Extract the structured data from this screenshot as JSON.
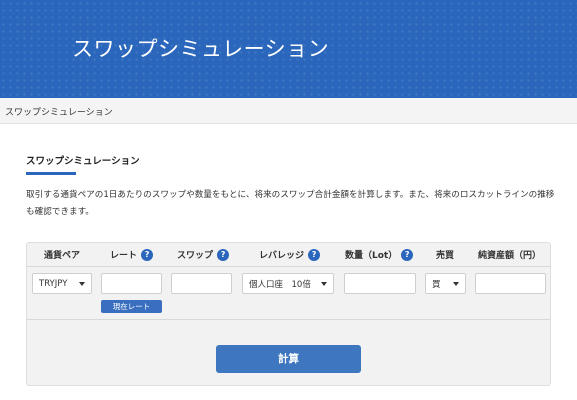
{
  "hero": {
    "title": "スワップシミュレーション"
  },
  "breadcrumb": {
    "current": "スワップシミュレーション"
  },
  "section": {
    "title": "スワップシミュレーション",
    "description": "取引する通貨ペアの1日あたりのスワップや数量をもとに、将来のスワップ合計金額を計算します。また、将来のロスカットラインの推移も確認できます。"
  },
  "table": {
    "headers": {
      "pair": "通貨ペア",
      "rate": "レート",
      "swap": "スワップ",
      "leverage": "レバレッジ",
      "quantity": "数量（Lot）",
      "side": "売買",
      "equity": "純資産額（円）"
    },
    "help_glyph": "?",
    "row": {
      "pair": "TRYJPY",
      "rate": "",
      "swap": "",
      "leverage": "個人口座　10倍",
      "quantity": "",
      "side": "買",
      "equity": ""
    },
    "current_rate_label": "現在レート"
  },
  "calculate_label": "計算",
  "colors": {
    "brand": "#2a66bb",
    "button": "#3e76c0"
  }
}
